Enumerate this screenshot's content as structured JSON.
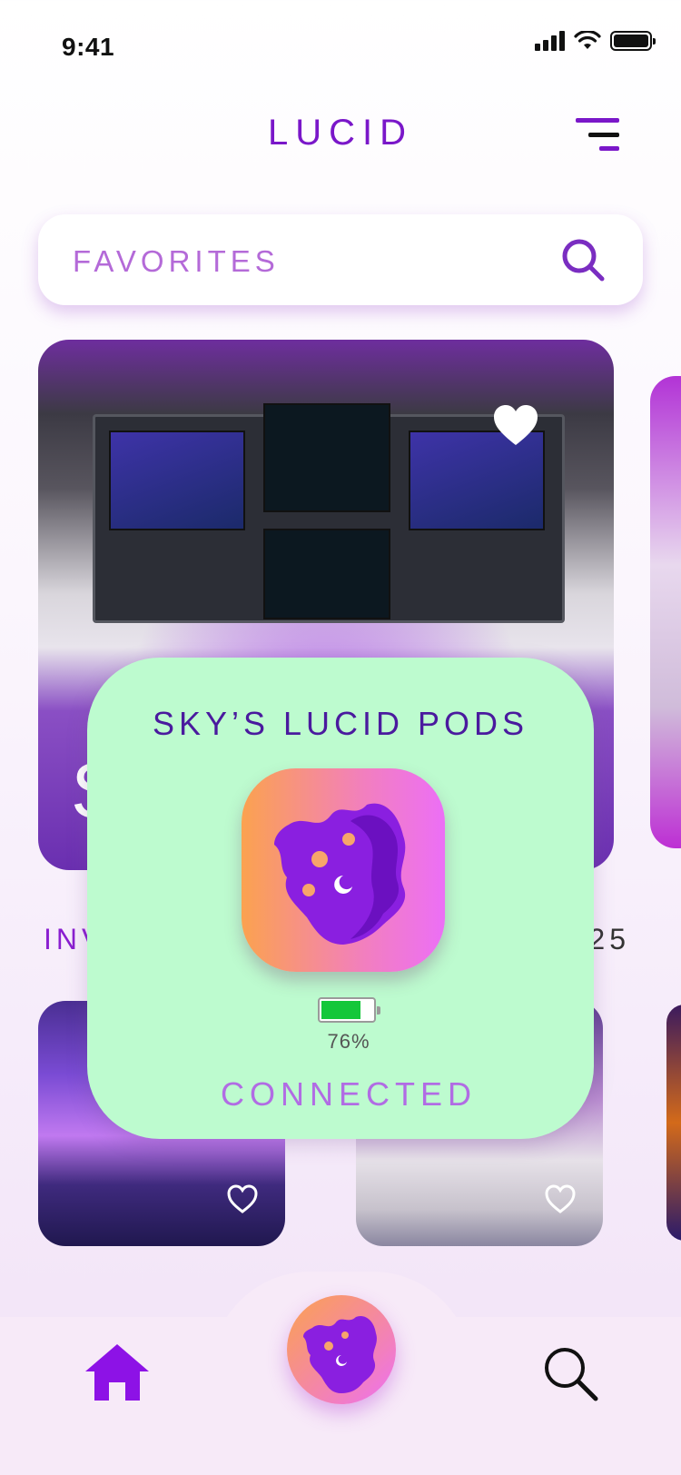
{
  "status_bar": {
    "time": "9:41",
    "icons": [
      "signal-icon",
      "wifi-icon",
      "battery-icon"
    ]
  },
  "header": {
    "title": "LUCID",
    "menu_icon": "menu-icon"
  },
  "search": {
    "text": "FAVORITES",
    "icon": "search-icon"
  },
  "cards": {
    "featured_initial": "S",
    "row_label_left": "INV",
    "row_label_right": "25",
    "heart_icon": "heart-icon"
  },
  "popup": {
    "title": "SKY’S LUCID PODS",
    "battery_level": 0.76,
    "battery_text": "76%",
    "status": "CONNECTED"
  },
  "tab_bar": {
    "items": [
      "home-icon",
      "lucid-logo",
      "search-icon"
    ]
  },
  "colors": {
    "accent": "#7a17c9",
    "popup_bg": "#bdfbcf",
    "status_text": "#b16ce4",
    "battery_green": "#14c73a"
  }
}
